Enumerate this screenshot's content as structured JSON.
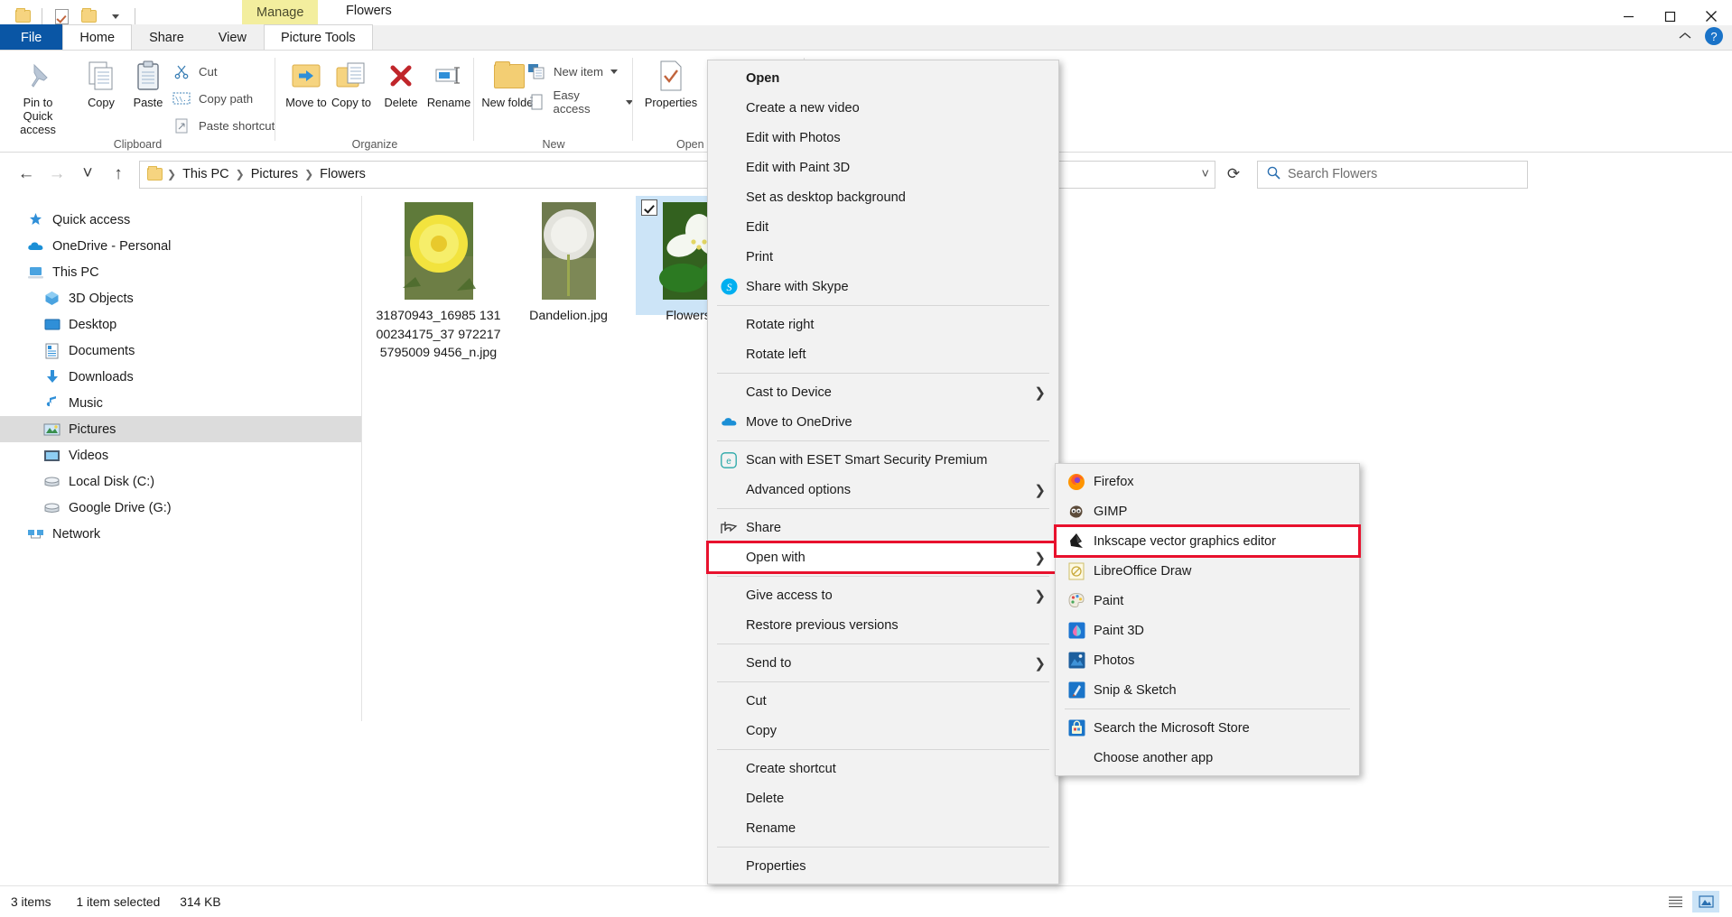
{
  "window": {
    "title": "Flowers",
    "contextual_tab_label": "Manage",
    "minimize_label": "—",
    "maximize_label": "❐",
    "close_label": "✕"
  },
  "quick_access_toolbar": {
    "items": [
      {
        "name": "folder-icon",
        "label": ""
      },
      {
        "name": "properties-check-icon",
        "label": ""
      },
      {
        "name": "new-folder-icon",
        "label": ""
      },
      {
        "name": "customize-dropdown-icon",
        "label": ""
      }
    ]
  },
  "ribbon": {
    "tabs": [
      {
        "label": "File",
        "active": false,
        "kind": "file"
      },
      {
        "label": "Home",
        "active": true,
        "kind": "normal"
      },
      {
        "label": "Share",
        "active": false,
        "kind": "normal"
      },
      {
        "label": "View",
        "active": false,
        "kind": "normal"
      },
      {
        "label": "Picture Tools",
        "active": false,
        "kind": "contextual"
      }
    ],
    "collapse_icon": "⌃",
    "help_icon": "?",
    "groups": [
      {
        "name": "Clipboard",
        "big_buttons": [
          {
            "label": "Pin to Quick access",
            "icon": "pin-icon"
          },
          {
            "label": "Copy",
            "icon": "copy-icon"
          },
          {
            "label": "Paste",
            "icon": "paste-icon"
          }
        ],
        "small_buttons": [
          {
            "label": "Cut",
            "icon": "scissors-icon"
          },
          {
            "label": "Copy path",
            "icon": "copy-path-icon"
          },
          {
            "label": "Paste shortcut",
            "icon": "paste-shortcut-icon"
          }
        ]
      },
      {
        "name": "Organize",
        "big_buttons": [
          {
            "label": "Move to",
            "icon": "move-to-icon",
            "has_dropdown": true
          },
          {
            "label": "Copy to",
            "icon": "copy-to-icon",
            "has_dropdown": true
          },
          {
            "label": "Delete",
            "icon": "delete-x-icon",
            "has_dropdown": true
          },
          {
            "label": "Rename",
            "icon": "rename-icon"
          }
        ]
      },
      {
        "name": "New",
        "big_buttons": [
          {
            "label": "New folder",
            "icon": "new-folder-icon"
          }
        ],
        "small_buttons": [
          {
            "label": "New item",
            "icon": "new-item-icon",
            "has_dropdown": true
          },
          {
            "label": "Easy access",
            "icon": "easy-access-icon",
            "has_dropdown": true
          }
        ]
      },
      {
        "name": "Open",
        "big_buttons": [
          {
            "label": "Properties",
            "icon": "properties-icon",
            "has_dropdown": true
          }
        ]
      }
    ]
  },
  "addressbar": {
    "back_icon": "←",
    "forward_icon": "→",
    "recent_icon": "˅",
    "up_icon": "↑",
    "breadcrumbs": [
      "This PC",
      "Pictures",
      "Flowers"
    ],
    "dropdown_icon": "˅",
    "refresh_icon": "⟳",
    "search_icon": "search-icon",
    "search_placeholder": "Search Flowers",
    "search_value": ""
  },
  "navpane": {
    "items": [
      {
        "label": "Quick access",
        "icon": "star-pin-icon",
        "level": 0,
        "selected": false
      },
      {
        "label": "OneDrive - Personal",
        "icon": "onedrive-cloud-icon",
        "level": 0,
        "selected": false
      },
      {
        "label": "This PC",
        "icon": "this-pc-icon",
        "level": 0,
        "selected": false
      },
      {
        "label": "3D Objects",
        "icon": "3d-objects-icon",
        "level": 1,
        "selected": false
      },
      {
        "label": "Desktop",
        "icon": "desktop-icon",
        "level": 1,
        "selected": false
      },
      {
        "label": "Documents",
        "icon": "documents-icon",
        "level": 1,
        "selected": false
      },
      {
        "label": "Downloads",
        "icon": "downloads-icon",
        "level": 1,
        "selected": false
      },
      {
        "label": "Music",
        "icon": "music-icon",
        "level": 1,
        "selected": false
      },
      {
        "label": "Pictures",
        "icon": "pictures-icon",
        "level": 1,
        "selected": true
      },
      {
        "label": "Videos",
        "icon": "videos-icon",
        "level": 1,
        "selected": false
      },
      {
        "label": "Local Disk (C:)",
        "icon": "disk-icon",
        "level": 1,
        "selected": false
      },
      {
        "label": "Google Drive (G:)",
        "icon": "disk-icon",
        "level": 1,
        "selected": false
      },
      {
        "label": "Network",
        "icon": "network-icon",
        "level": 0,
        "selected": false
      }
    ]
  },
  "files": [
    {
      "name": "31870943_16985 13100234175_37 9722175795009 9456_n.jpg",
      "selected": false,
      "checked": false,
      "thumb": "dandelion-yellow"
    },
    {
      "name": "Dandelion.jpg",
      "selected": false,
      "checked": false,
      "thumb": "dandelion-seed"
    },
    {
      "name": "Flowers.jpg",
      "selected": true,
      "checked": true,
      "thumb": "white-flower"
    }
  ],
  "statusbar": {
    "item_count": "3 items",
    "selection": "1 item selected",
    "size": "314 KB",
    "view_details_icon": "details-view-icon",
    "view_large_icons_icon": "large-icons-view-icon"
  },
  "context_menu": {
    "items": [
      {
        "label": "Open",
        "bold": true,
        "icon": null,
        "arrow": false,
        "highlight": false
      },
      {
        "label": "Create a new video",
        "bold": false,
        "icon": null,
        "arrow": false,
        "highlight": false
      },
      {
        "label": "Edit with Photos",
        "bold": false,
        "icon": null,
        "arrow": false,
        "highlight": false
      },
      {
        "label": "Edit with Paint 3D",
        "bold": false,
        "icon": null,
        "arrow": false,
        "highlight": false
      },
      {
        "label": "Set as desktop background",
        "bold": false,
        "icon": null,
        "arrow": false,
        "highlight": false
      },
      {
        "label": "Edit",
        "bold": false,
        "icon": null,
        "arrow": false,
        "highlight": false
      },
      {
        "label": "Print",
        "bold": false,
        "icon": null,
        "arrow": false,
        "highlight": false
      },
      {
        "label": "Share with Skype",
        "bold": false,
        "icon": "skype-icon",
        "arrow": false,
        "highlight": false
      },
      {
        "separator": true
      },
      {
        "label": "Rotate right",
        "bold": false,
        "icon": null,
        "arrow": false,
        "highlight": false
      },
      {
        "label": "Rotate left",
        "bold": false,
        "icon": null,
        "arrow": false,
        "highlight": false
      },
      {
        "separator": true
      },
      {
        "label": "Cast to Device",
        "bold": false,
        "icon": null,
        "arrow": true,
        "highlight": false
      },
      {
        "label": "Move to OneDrive",
        "bold": false,
        "icon": "onedrive-cloud-icon",
        "arrow": false,
        "highlight": false
      },
      {
        "separator": true
      },
      {
        "label": "Scan with ESET Smart Security Premium",
        "bold": false,
        "icon": "eset-icon",
        "arrow": false,
        "highlight": false
      },
      {
        "label": "Advanced options",
        "bold": false,
        "icon": null,
        "arrow": true,
        "highlight": false
      },
      {
        "separator": true
      },
      {
        "label": "Share",
        "bold": false,
        "icon": "share-icon",
        "arrow": false,
        "highlight": false
      },
      {
        "label": "Open with",
        "bold": false,
        "icon": null,
        "arrow": true,
        "highlight": true
      },
      {
        "separator": true
      },
      {
        "label": "Give access to",
        "bold": false,
        "icon": null,
        "arrow": true,
        "highlight": false
      },
      {
        "label": "Restore previous versions",
        "bold": false,
        "icon": null,
        "arrow": false,
        "highlight": false
      },
      {
        "separator": true
      },
      {
        "label": "Send to",
        "bold": false,
        "icon": null,
        "arrow": true,
        "highlight": false
      },
      {
        "separator": true
      },
      {
        "label": "Cut",
        "bold": false,
        "icon": null,
        "arrow": false,
        "highlight": false
      },
      {
        "label": "Copy",
        "bold": false,
        "icon": null,
        "arrow": false,
        "highlight": false
      },
      {
        "separator": true
      },
      {
        "label": "Create shortcut",
        "bold": false,
        "icon": null,
        "arrow": false,
        "highlight": false
      },
      {
        "label": "Delete",
        "bold": false,
        "icon": null,
        "arrow": false,
        "highlight": false
      },
      {
        "label": "Rename",
        "bold": false,
        "icon": null,
        "arrow": false,
        "highlight": false
      },
      {
        "separator": true
      },
      {
        "label": "Properties",
        "bold": false,
        "icon": null,
        "arrow": false,
        "highlight": false
      }
    ]
  },
  "open_with_submenu": {
    "items": [
      {
        "label": "Firefox",
        "icon": "firefox-icon",
        "highlight": false
      },
      {
        "label": "GIMP",
        "icon": "gimp-icon",
        "highlight": false
      },
      {
        "label": "Inkscape vector graphics editor",
        "icon": "inkscape-icon",
        "highlight": true
      },
      {
        "label": "LibreOffice Draw",
        "icon": "libreoffice-draw-icon",
        "highlight": false
      },
      {
        "label": "Paint",
        "icon": "paint-icon",
        "highlight": false
      },
      {
        "label": "Paint 3D",
        "icon": "paint3d-icon",
        "highlight": false
      },
      {
        "label": "Photos",
        "icon": "photos-icon",
        "highlight": false
      },
      {
        "label": "Snip & Sketch",
        "icon": "snip-sketch-icon",
        "highlight": false
      },
      {
        "separator": true
      },
      {
        "label": "Search the Microsoft Store",
        "icon": "microsoft-store-icon",
        "highlight": false
      },
      {
        "label": "Choose another app",
        "icon": null,
        "highlight": false
      }
    ]
  },
  "colors": {
    "accent_blue": "#0a56a5",
    "selection_blue": "#cce4f7",
    "highlight_red": "#e8112d",
    "contextual_tab_yellow": "#f3ee9e",
    "menu_bg": "#f2f2f2"
  }
}
